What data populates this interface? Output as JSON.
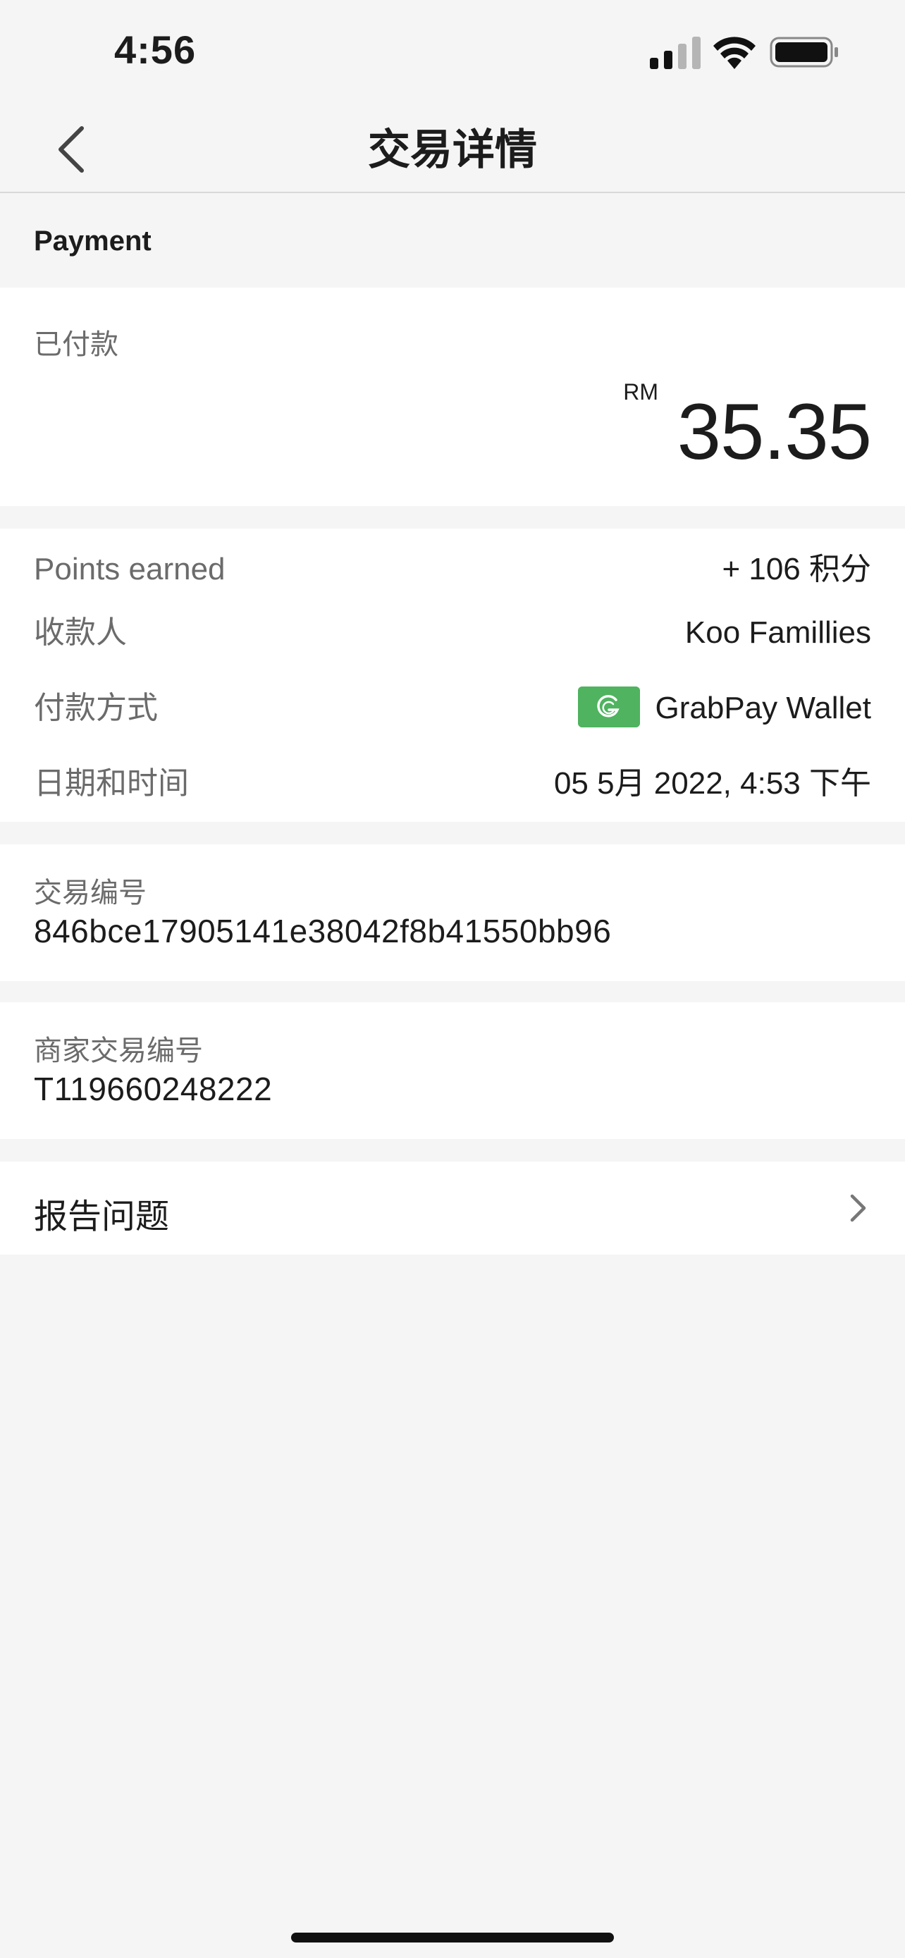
{
  "status_bar": {
    "time": "4:56",
    "icons": [
      "cellular-signal-icon",
      "wifi-icon",
      "battery-icon"
    ]
  },
  "nav": {
    "title": "交易详情",
    "back_icon": "chevron-left-icon"
  },
  "section": {
    "title": "Payment"
  },
  "paid": {
    "label": "已付款",
    "currency": "RM",
    "amount": "35.35"
  },
  "details": {
    "points_label": "Points earned",
    "points_value": "+ 106 积分",
    "payee_label": "收款人",
    "payee_value": "Koo Famillies",
    "method_label": "付款方式",
    "method_value": "GrabPay Wallet",
    "method_icon": "grabpay-logo-icon",
    "datetime_label": "日期和时间",
    "datetime_value": "05 5月 2022, 4:53 下午"
  },
  "transaction": {
    "label": "交易编号",
    "value": "846bce17905141e38042f8b41550bb96"
  },
  "merchant_transaction": {
    "label": "商家交易编号",
    "value": "T119660248222"
  },
  "report": {
    "label": "报告问题",
    "icon": "chevron-right-icon"
  },
  "colors": {
    "background": "#f5f5f5",
    "card": "#ffffff",
    "grab_green": "#4fb35f",
    "label_gray": "#6b6b6b"
  }
}
